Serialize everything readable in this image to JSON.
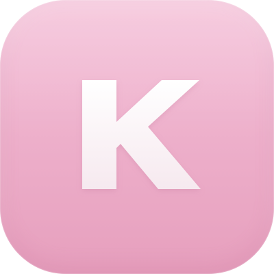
{
  "icon": {
    "letter": "K",
    "background_colors": [
      "#f5c3da",
      "#eeb1cc",
      "#e69fbd"
    ],
    "letter_colors": [
      "#ffffff",
      "#f6e9ef"
    ]
  }
}
